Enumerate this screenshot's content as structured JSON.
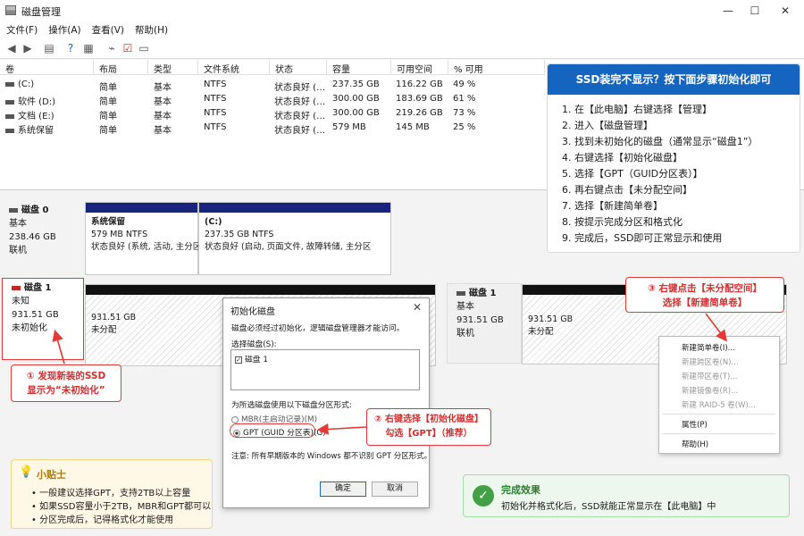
{
  "window": {
    "title": "磁盘管理"
  },
  "menu": [
    "文件(F)",
    "操作(A)",
    "查看(V)",
    "帮助(H)"
  ],
  "volume_table": {
    "columns": [
      "卷",
      "布局",
      "类型",
      "文件系统",
      "状态",
      "容量",
      "可用空间",
      "% 可用"
    ],
    "rows": [
      [
        "(C:)",
        "简单",
        "基本",
        "NTFS",
        "状态良好 (…",
        "237.35 GB",
        "116.22 GB",
        "49 %"
      ],
      [
        "软件 (D:)",
        "简单",
        "基本",
        "NTFS",
        "状态良好 (…",
        "300.00 GB",
        "183.69 GB",
        "61 %"
      ],
      [
        "文档 (E:)",
        "简单",
        "基本",
        "NTFS",
        "状态良好 (…",
        "300.00 GB",
        "219.26 GB",
        "73 %"
      ],
      [
        "系统保留",
        "简单",
        "基本",
        "NTFS",
        "状态良好 (…",
        "579 MB",
        "145 MB",
        "25 %"
      ]
    ]
  },
  "disk0": {
    "name": "磁盘 0",
    "type": "基本",
    "size": "238.46 GB",
    "status": "联机",
    "partitions": [
      {
        "name": "系统保留",
        "size": "579 MB NTFS",
        "status": "状态良好 (系统, 活动, 主分区"
      },
      {
        "name": "(C:)",
        "size": "237.35 GB NTFS",
        "status": "状态良好 (启动, 页面文件, 故障转储, 主分区"
      }
    ]
  },
  "disk1_left": {
    "name": "磁盘 1",
    "type": "未知",
    "size": "931.51 GB",
    "status": "未初始化",
    "part_size": "931.51 GB",
    "part_label": "未分配"
  },
  "disk1_right": {
    "name": "磁盘 1",
    "type": "基本",
    "size": "931.51 GB",
    "status": "联机",
    "part_size": "931.51 GB",
    "part_label": "未分配"
  },
  "info_panel": {
    "title": "SSD装完不显示？按下面步骤初始化即可",
    "steps": [
      "1. 在【此电脑】右键选择【管理】",
      "2. 进入【磁盘管理】",
      "3. 找到未初始化的磁盘（通常显示“磁盘1”）",
      "4. 右键选择【初始化磁盘】",
      "5. 选择【GPT（GUID分区表）】",
      "6. 再右键点击【未分配空间】",
      "7. 选择【新建简单卷】",
      "8. 按提示完成分区和格式化",
      "9. 完成后，SSD即可正常显示和使用"
    ]
  },
  "dialog": {
    "title": "初始化磁盘",
    "desc": "磁盘必须经过初始化，逻辑磁盘管理器才能访问。",
    "select_label": "选择磁盘(S):",
    "disk_item": "磁盘 1",
    "style_label": "为所选磁盘使用以下磁盘分区形式:",
    "mbr": "MBR(主启动记录)(M)",
    "gpt": "GPT (GUID 分区表)(G)",
    "note": "注意: 所有早期版本的 Windows 都不识别 GPT 分区形式。",
    "ok": "确定",
    "cancel": "取消"
  },
  "context_menu": {
    "items": [
      "新建简单卷(I)...",
      "新建跨区卷(N)...",
      "新建带区卷(T)...",
      "新建镜像卷(R)...",
      "新建 RAID-5 卷(W)...",
      "属性(P)",
      "帮助(H)"
    ]
  },
  "callouts": {
    "c1": [
      "① 发现新装的SSD",
      "显示为“未初始化”"
    ],
    "c2": [
      "② 右键选择【初始化磁盘】",
      "勾选【GPT】（推荐）"
    ],
    "c3": [
      "③ 右键点击【未分配空间】",
      "选择【新建简单卷】"
    ]
  },
  "tips": {
    "title": "小贴士",
    "items": [
      "• 一般建议选择GPT，支持2TB以上容量",
      "• 如果SSD容量小于2TB，MBR和GPT都可以",
      "• 分区完成后，记得格式化才能使用"
    ]
  },
  "result": {
    "title": "完成效果",
    "text": "初始化并格式化后，SSD就能正常显示在【此电脑】中"
  },
  "colors": {
    "accent": "#1565c0",
    "callout_red": "#e53935",
    "disk_bar_blue": "#1a237e",
    "success_green": "#43a047"
  }
}
